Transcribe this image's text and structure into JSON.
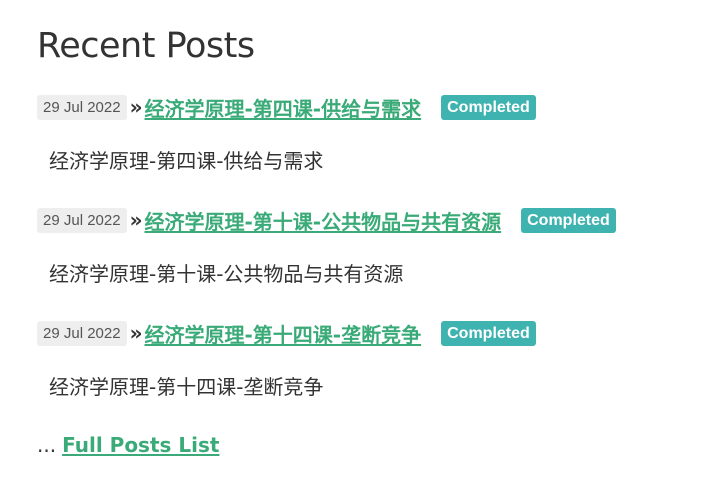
{
  "section": {
    "title": "Recent Posts"
  },
  "posts": [
    {
      "date": "29 Jul 2022",
      "arrow": "»",
      "title": "经济学原理-第四课-供给与需求",
      "status": "Completed",
      "excerpt": "经济学原理-第四课-供给与需求"
    },
    {
      "date": "29 Jul 2022",
      "arrow": "»",
      "title": "经济学原理-第十课-公共物品与共有资源",
      "status": "Completed",
      "excerpt": "经济学原理-第十课-公共物品与共有资源"
    },
    {
      "date": "29 Jul 2022",
      "arrow": "»",
      "title": "经济学原理-第十四课-垄断竞争",
      "status": "Completed",
      "excerpt": "经济学原理-第十四课-垄断竞争"
    }
  ],
  "footer": {
    "ellipsis": "...",
    "link_label": "Full Posts List"
  },
  "colors": {
    "link": "#3aab78",
    "status_badge": "#3fb3b0",
    "date_badge": "#eeeeee",
    "text": "#333333"
  }
}
